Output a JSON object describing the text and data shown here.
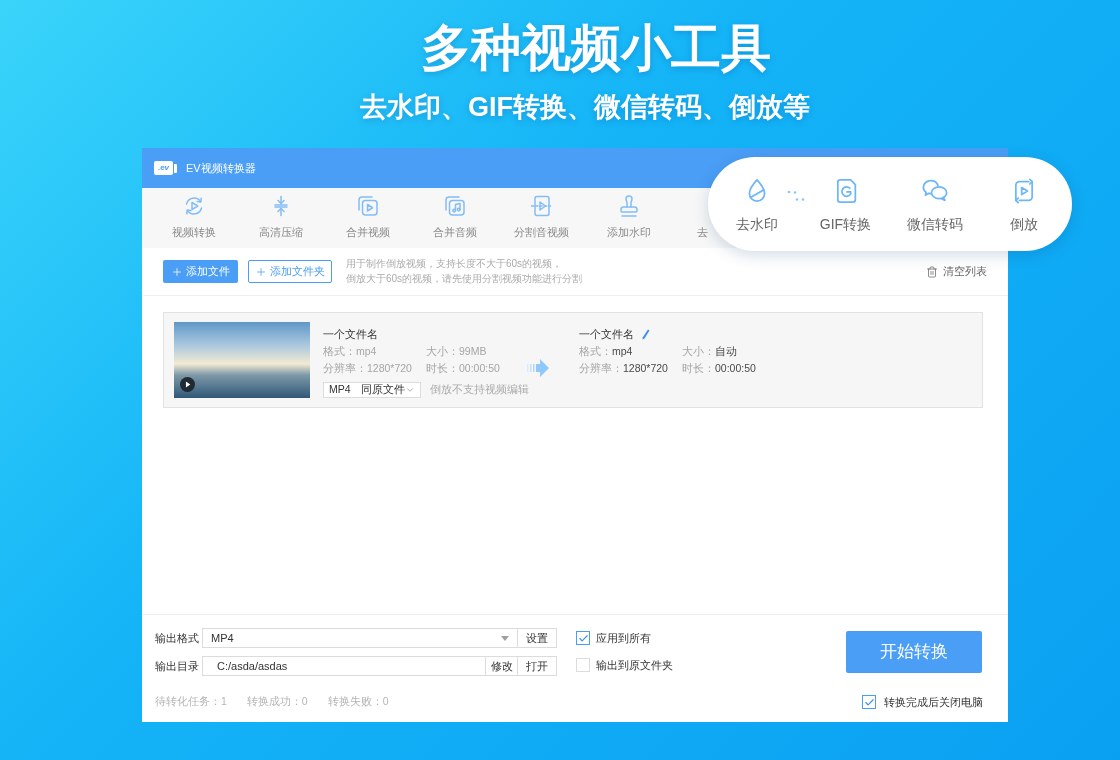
{
  "banner": {
    "title": "多种视频小工具",
    "subtitle": "去水印、GIF转换、微信转码、倒放等"
  },
  "window": {
    "logo": ".ev",
    "title": "EV视频转换器"
  },
  "toolbar": [
    {
      "kind": "convert",
      "label": "视频转换"
    },
    {
      "kind": "compress",
      "label": "高清压缩"
    },
    {
      "kind": "merge_video",
      "label": "合并视频"
    },
    {
      "kind": "merge_audio",
      "label": "合并音频"
    },
    {
      "kind": "split",
      "label": "分割音视频"
    },
    {
      "kind": "watermark",
      "label": "添加水印"
    },
    {
      "kind": "covered",
      "label": "去"
    }
  ],
  "popup": [
    {
      "kind": "remove_watermark",
      "label": "去水印"
    },
    {
      "kind": "gif",
      "label": "GIF转换"
    },
    {
      "kind": "wechat",
      "label": "微信转码"
    },
    {
      "kind": "reverse",
      "label": "倒放"
    }
  ],
  "actions": {
    "add_file": "添加文件",
    "add_folder": "添加文件夹",
    "hint": [
      "用于制作倒放视频，支持长度不大于60s的视频，",
      "倒放大于60s的视频，请先使用分割视频功能进行分割"
    ],
    "clear": "清空列表"
  },
  "files": [
    {
      "source": {
        "name": "一个文件名",
        "fields": [
          {
            "label": "格式：",
            "value": "mp4"
          },
          {
            "label": "大小：",
            "value": "99MB"
          },
          {
            "label": "分辨率：",
            "value": "1280*720"
          },
          {
            "label": "时长：",
            "value": "00:00:50"
          }
        ]
      },
      "format": "MP4",
      "folder": "同原文件",
      "note": "倒放不支持视频编辑",
      "target": {
        "name": "一个文件名",
        "fields": [
          {
            "label": "格式：",
            "value": "mp4"
          },
          {
            "label": "大小：",
            "value": "自动"
          },
          {
            "label": "分辨率：",
            "value": "1280*720"
          },
          {
            "label": "时长：",
            "value": "00:00:50"
          }
        ]
      }
    }
  ],
  "output": {
    "format_label": "输出格式",
    "format_value": "MP4",
    "settings": "设置",
    "dir_label": "输出目录",
    "dir_value": "C:/asda/asdas",
    "modify": "修改",
    "open": "打开"
  },
  "options": [
    {
      "label": "应用到所有",
      "checked": true
    },
    {
      "label": "输出到原文件夹",
      "checked": false
    }
  ],
  "start_button": "开始转换",
  "status": [
    "待转化任务：1",
    "转换成功：0",
    "转换失败：0"
  ],
  "shutdown": {
    "label": "转换完成后关闭电脑",
    "checked": true
  }
}
